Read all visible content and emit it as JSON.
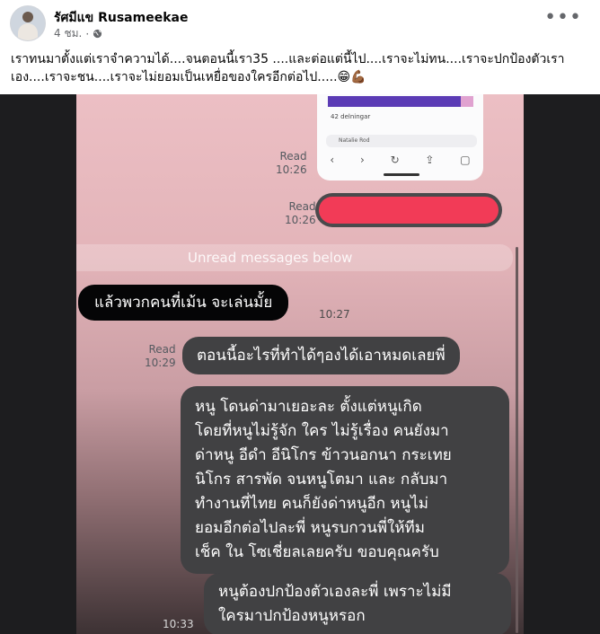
{
  "post": {
    "author": "รัศมีแข Rusameekae",
    "time": "4 ชม.",
    "privacy_icon": "globe-icon",
    "more_icon": "more-options-icon",
    "caption": "เราทนมาตั้งแต่เราจำความได้....จนตอนนี้เรา35 ....และต่อแต่นี้ไป....เราจะไม่ทน....เราจะปกป้องตัวเรา\nเอง....เราจะชน....เราจะไม่ยอมเป็นเหยื่อของใครอีกต่อไป.....😁💪🏾"
  },
  "chat": {
    "card": {
      "count": "42 delningar",
      "reply_name": "Natalie Rod"
    },
    "read_1": {
      "status": "Read",
      "time": "10:26"
    },
    "read_2": {
      "status": "Read",
      "time": "10:26"
    },
    "unread_banner": "Unread messages below",
    "msg_1": {
      "text": "แล้วพวกคนที่เม้น จะเล่นมั้ย",
      "time": "10:27"
    },
    "read_3": {
      "status": "Read",
      "time": "10:29"
    },
    "msg_2": {
      "text": "ตอนนี้อะไรที่ทำได้ๆองได้เอาหมดเลยพี่"
    },
    "msg_3": {
      "text": "หนู โดนด่ามาเยอะละ ตั้งแต่หนูเกิด\nโดยที่หนูไม่รู้จัก ใคร ไม่รู้เรื่อง คนยังมา\nด่าหนู อีดำ อีนิโกร ข้าวนอกนา กระเทย\nนิโกร สารพัด จนหนูโตมา และ กลับมา\nทำงานที่ไทย คนก็ยังด่าหนูอีก หนูไม่\nยอมอีกต่อไปละพี่ หนูรบกวนพี่ให้ทีม\nเช็ค ใน โซเชี่ยลเลยครับ ขอบคุณครับ"
    },
    "msg_4": {
      "text": "หนูต้องปกป้องตัวเองละพี่ เพราะไม่มี\nใครมาปกป้องหนูหรอก"
    },
    "bottom_time": "10:33"
  },
  "colors": {
    "redacted": "#f23b57",
    "incoming_bubble": "#050506",
    "outgoing_bubble": "#414143"
  }
}
